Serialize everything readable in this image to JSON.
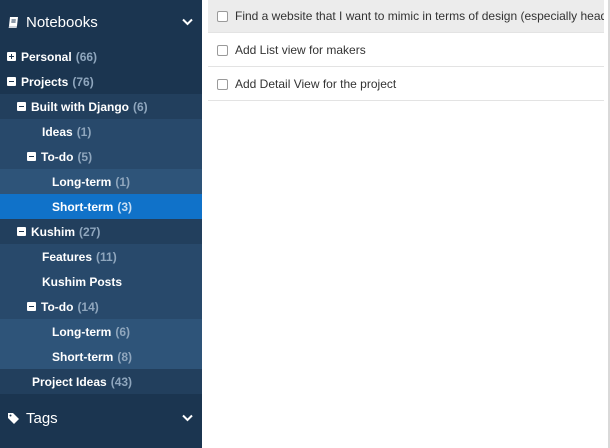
{
  "sidebar": {
    "notebooks_title": "Notebooks",
    "tags_title": "Tags",
    "tree": [
      {
        "label": "Personal",
        "count": "(66)",
        "toggle": "plus",
        "level": 0
      },
      {
        "label": "Projects",
        "count": "(76)",
        "toggle": "minus",
        "level": 0
      },
      {
        "label": "Built with Django",
        "count": "(6)",
        "toggle": "minus",
        "level": 1
      },
      {
        "label": "Ideas",
        "count": "(1)",
        "toggle": "none",
        "level": 2
      },
      {
        "label": "To-do",
        "count": "(5)",
        "toggle": "minus",
        "level": 2
      },
      {
        "label": "Long-term",
        "count": "(1)",
        "toggle": "none",
        "level": 3
      },
      {
        "label": "Short-term",
        "count": "(3)",
        "toggle": "none",
        "level": 3,
        "active": true
      },
      {
        "label": "Kushim",
        "count": "(27)",
        "toggle": "minus",
        "level": 1
      },
      {
        "label": "Features",
        "count": "(11)",
        "toggle": "none",
        "level": 2
      },
      {
        "label": "Kushim Posts",
        "count": "",
        "toggle": "none",
        "level": 2
      },
      {
        "label": "To-do",
        "count": "(14)",
        "toggle": "minus",
        "level": 2
      },
      {
        "label": "Long-term",
        "count": "(6)",
        "toggle": "none",
        "level": 3
      },
      {
        "label": "Short-term",
        "count": "(8)",
        "toggle": "none",
        "level": 3
      },
      {
        "label": "Project Ideas",
        "count": "(43)",
        "toggle": "none",
        "level": 1
      }
    ]
  },
  "tasks": [
    {
      "text": "Find a website that I want to mimic in terms of design (especially header)"
    },
    {
      "text": "Add List view for makers"
    },
    {
      "text": "Add Detail View for the project"
    }
  ],
  "colors": {
    "sidebar_bg": "#1b3550",
    "active_item": "#1072c9",
    "count_text": "#8fa6bd"
  },
  "icons": {
    "notebooks": "notebook-icon",
    "tags": "tag-icon",
    "expand": "chevron-down-icon"
  }
}
